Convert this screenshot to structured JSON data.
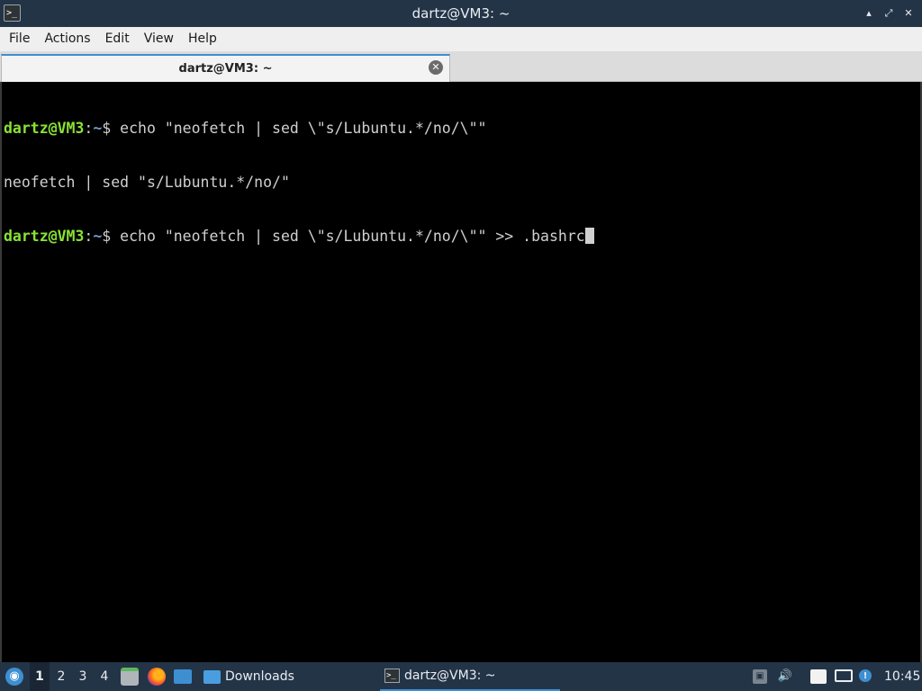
{
  "window": {
    "title": "dartz@VM3: ~",
    "app_icon": "terminal-icon",
    "app_icon_glyph": ">_",
    "minimize_glyph": "▴",
    "maximize_glyph": "⤢",
    "close_glyph": "✕"
  },
  "menu": [
    "File",
    "Actions",
    "Edit",
    "View",
    "Help"
  ],
  "tab": {
    "label": "dartz@VM3: ~",
    "close_glyph": "✕"
  },
  "terminal": {
    "lines": [
      {
        "user": "dartz@VM3",
        "path": "~",
        "cmd": "$ echo \"neofetch | sed \\\"s/Lubuntu.*/no/\\\"\""
      },
      {
        "output": "neofetch | sed \"s/Lubuntu.*/no/\""
      },
      {
        "user": "dartz@VM3",
        "path": "~",
        "cmd": "$ echo \"neofetch | sed \\\"s/Lubuntu.*/no/\\\"\" >> .bashrc"
      }
    ],
    "colors": {
      "prompt_user": "#8ae234",
      "prompt_path": "#729fcf",
      "text": "#d0d0d0",
      "background": "#000000"
    }
  },
  "taskbar": {
    "start_icon": "lubuntu-logo-icon",
    "workspaces": [
      "1",
      "2",
      "3",
      "4"
    ],
    "active_workspace": "1",
    "quicklaunch": [
      "files-icon",
      "firefox-icon",
      "show-desktop-icon"
    ],
    "tasks": [
      {
        "label": "Downloads",
        "icon": "folder-icon"
      },
      {
        "label": "dartz@VM3: ~",
        "icon": "terminal-icon",
        "icon_glyph": ">_"
      }
    ],
    "tray": {
      "network_glyph": "▣",
      "volume_glyph": "🔊",
      "clipboard_glyph": "📋",
      "display_glyph": "▭",
      "update_glyph": "!"
    },
    "clock": "10:45"
  },
  "colors": {
    "panel_bg": "#243447",
    "accent": "#3d8fd1"
  }
}
